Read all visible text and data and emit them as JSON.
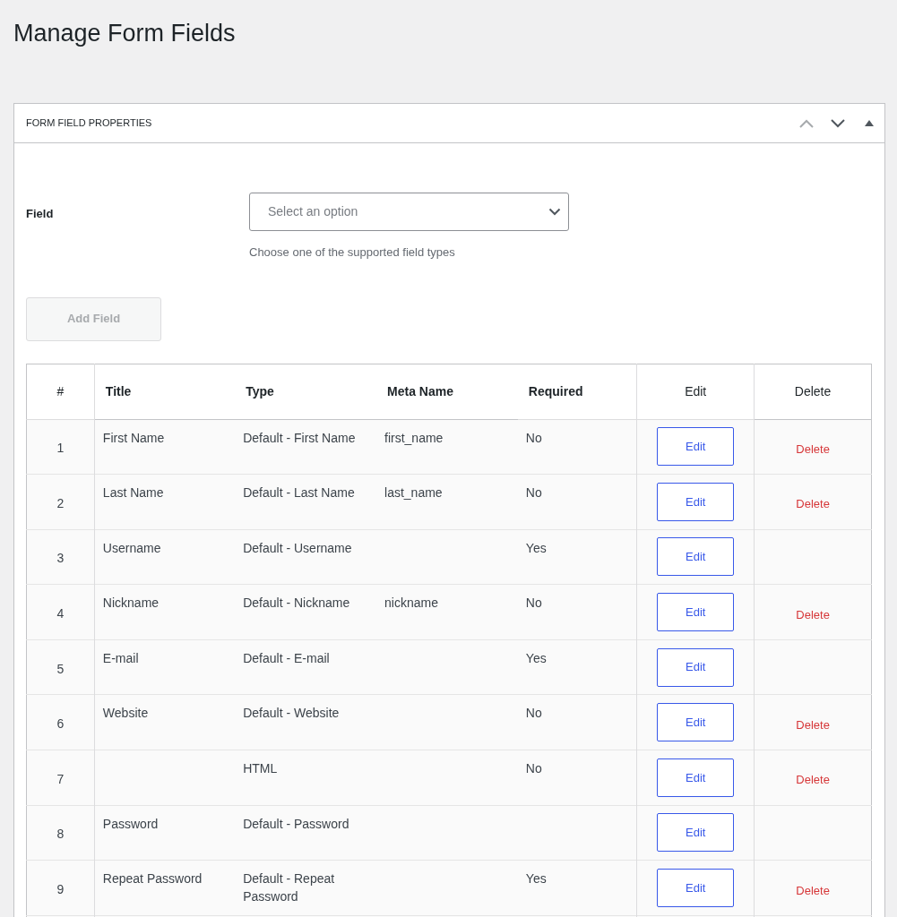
{
  "page_title": "Manage Form Fields",
  "panel": {
    "title": "FORM FIELD PROPERTIES",
    "expanded": true
  },
  "field": {
    "label": "Field",
    "placeholder": "Select an option",
    "hint": "Choose one of the supported field types"
  },
  "add_button": {
    "label": "Add Field",
    "disabled": true
  },
  "table": {
    "columns": [
      "#",
      "Title",
      "Type",
      "Meta Name",
      "Required",
      "Edit",
      "Delete"
    ],
    "rows": [
      {
        "number": "1",
        "title": "First Name",
        "type": "Default - First Name",
        "meta_name": "first_name",
        "required": "No",
        "edit": "Edit",
        "delete": "Delete"
      },
      {
        "number": "2",
        "title": "Last Name",
        "type": "Default - Last Name",
        "meta_name": "last_name",
        "required": "No",
        "edit": "Edit",
        "delete": "Delete"
      },
      {
        "number": "3",
        "title": "Username",
        "type": "Default - Username",
        "meta_name": "",
        "required": "Yes",
        "edit": "Edit",
        "delete": ""
      },
      {
        "number": "4",
        "title": "Nickname",
        "type": "Default - Nickname",
        "meta_name": "nickname",
        "required": "No",
        "edit": "Edit",
        "delete": "Delete"
      },
      {
        "number": "5",
        "title": "E-mail",
        "type": "Default - E-mail",
        "meta_name": "",
        "required": "Yes",
        "edit": "Edit",
        "delete": ""
      },
      {
        "number": "6",
        "title": "Website",
        "type": "Default - Website",
        "meta_name": "",
        "required": "No",
        "edit": "Edit",
        "delete": "Delete"
      },
      {
        "number": "7",
        "title": "",
        "type": "HTML",
        "meta_name": "",
        "required": "No",
        "edit": "Edit",
        "delete": "Delete"
      },
      {
        "number": "8",
        "title": "Password",
        "type": "Default - Password",
        "meta_name": "",
        "required": "",
        "edit": "Edit",
        "delete": ""
      },
      {
        "number": "9",
        "title": "Repeat Password",
        "type": "Default - Repeat Password",
        "meta_name": "",
        "required": "Yes",
        "edit": "Edit",
        "delete": "Delete"
      }
    ]
  }
}
